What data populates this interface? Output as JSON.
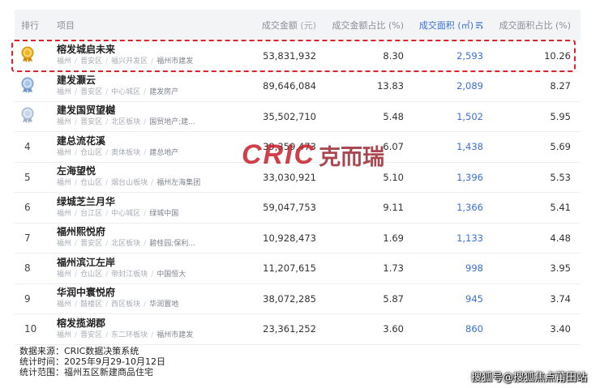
{
  "table": {
    "headers": {
      "rank": "排行",
      "project": "项目",
      "amount": "成交金额",
      "amount_unit": "(元)",
      "amount_share": "成交金额占比 (%)",
      "area": "成交面积 (㎡)",
      "area_share": "成交面积占比 (%)"
    },
    "rows": [
      {
        "rank": "1",
        "name": "榕发城启未来",
        "city": "福州",
        "district": "晋安区",
        "zone": "福兴开发区",
        "developer": "福州市建发",
        "amount": "53,831,932",
        "amount_share": "8.30",
        "area": "2,593",
        "area_share": "10.26",
        "medal": "gold"
      },
      {
        "rank": "2",
        "name": "建发灏云",
        "city": "福州",
        "district": "晋安区",
        "zone": "中心城区",
        "developer": "建发房产",
        "amount": "89,646,084",
        "amount_share": "13.83",
        "area": "2,089",
        "area_share": "8.27",
        "medal": "silver"
      },
      {
        "rank": "3",
        "name": "建发国贸望樾",
        "city": "福州",
        "district": "晋安区",
        "zone": "北区板块",
        "developer": "国贸地产;建...",
        "amount": "35,502,710",
        "amount_share": "5.48",
        "area": "1,502",
        "area_share": "5.95",
        "medal": "bronze"
      },
      {
        "rank": "4",
        "name": "建总流花溪",
        "city": "福州",
        "district": "仓山区",
        "zone": "奥体板块",
        "developer": "建总地产",
        "amount": "39,359,473",
        "amount_share": "6.07",
        "area": "1,438",
        "area_share": "5.69",
        "medal": ""
      },
      {
        "rank": "5",
        "name": "左海望悦",
        "city": "福州",
        "district": "仓山区",
        "zone": "烟台山板块",
        "developer": "福州左海集团",
        "amount": "33,030,921",
        "amount_share": "5.10",
        "area": "1,396",
        "area_share": "5.53",
        "medal": ""
      },
      {
        "rank": "6",
        "name": "绿城芝兰月华",
        "city": "福州",
        "district": "台江区",
        "zone": "中心城区",
        "developer": "绿城中国",
        "amount": "59,047,753",
        "amount_share": "9.11",
        "area": "1,366",
        "area_share": "5.41",
        "medal": ""
      },
      {
        "rank": "7",
        "name": "福州熙悦府",
        "city": "福州",
        "district": "晋安区",
        "zone": "北区板块",
        "developer": "碧桂园;保利...",
        "amount": "10,928,473",
        "amount_share": "1.69",
        "area": "1,133",
        "area_share": "4.48",
        "medal": ""
      },
      {
        "rank": "8",
        "name": "福州滨江左岸",
        "city": "福州",
        "district": "仓山区",
        "zone": "帝封江板块",
        "developer": "中国恒大",
        "amount": "11,207,615",
        "amount_share": "1.73",
        "area": "998",
        "area_share": "3.95",
        "medal": ""
      },
      {
        "rank": "9",
        "name": "华润中寰悦府",
        "city": "福州",
        "district": "鼓楼区",
        "zone": "西区板块",
        "developer": "华润置地",
        "amount": "38,072,285",
        "amount_share": "5.87",
        "area": "945",
        "area_share": "3.74",
        "medal": ""
      },
      {
        "rank": "10",
        "name": "榕发揽湖郡",
        "city": "福州",
        "district": "晋安区",
        "zone": "东二环板块",
        "developer": "福州市建发",
        "amount": "23,361,252",
        "amount_share": "3.60",
        "area": "860",
        "area_share": "3.40",
        "medal": ""
      }
    ]
  },
  "watermark": {
    "latin": "CRIC",
    "cn": "克而瑞"
  },
  "footer": {
    "source": "数据来源：CRIC数据决策系统",
    "period": "统计时间：2025年9月29-10月12日",
    "scope": "统计范围：福州五区新建商品住宅"
  },
  "credit": "搜狐号@搜狐焦点莆田站",
  "colors": {
    "accent_blue": "#3b6fd4",
    "highlight_red": "#d8242a",
    "gold": "#e8a317",
    "silver": "#8fb3dc",
    "bronze": "#b9c9dd",
    "watermark_red": "#c81f2c"
  }
}
